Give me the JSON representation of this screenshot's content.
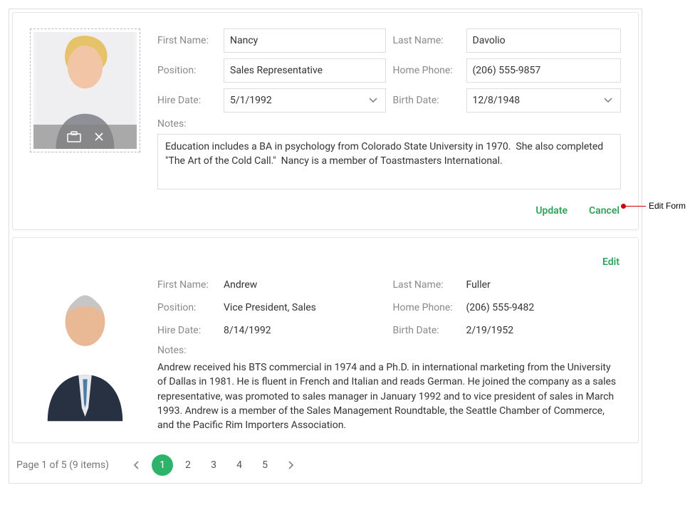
{
  "edit_card": {
    "labels": {
      "first_name": "First Name:",
      "last_name": "Last Name:",
      "position": "Position:",
      "home_phone": "Home Phone:",
      "hire_date": "Hire Date:",
      "birth_date": "Birth Date:",
      "notes": "Notes:"
    },
    "values": {
      "first_name": "Nancy",
      "last_name": "Davolio",
      "position": "Sales Representative",
      "home_phone": "(206) 555-9857",
      "hire_date": "5/1/1992",
      "birth_date": "12/8/1948",
      "notes": "Education includes a BA in psychology from Colorado State University in 1970.  She also completed \"The Art of the Cold Call.\"  Nancy is a member of Toastmasters International."
    },
    "buttons": {
      "update": "Update",
      "cancel": "Cancel"
    }
  },
  "read_card": {
    "edit_label": "Edit",
    "labels": {
      "first_name": "First Name:",
      "last_name": "Last Name:",
      "position": "Position:",
      "home_phone": "Home Phone:",
      "hire_date": "Hire Date:",
      "birth_date": "Birth Date:",
      "notes": "Notes:"
    },
    "values": {
      "first_name": "Andrew",
      "last_name": "Fuller",
      "position": "Vice President, Sales",
      "home_phone": "(206) 555-9482",
      "hire_date": "8/14/1992",
      "birth_date": "2/19/1952",
      "notes": "Andrew received his BTS commercial in 1974 and a Ph.D. in international marketing from the University of Dallas in 1981. He is fluent in French and Italian and reads German. He joined the company as a sales representative, was promoted to sales manager in January 1992 and to vice president of sales in March 1993. Andrew is a member of the Sales Management Roundtable, the Seattle Chamber of Commerce, and the Pacific Rim Importers Association."
    }
  },
  "pager": {
    "info": "Page 1 of 5 (9 items)",
    "pages": [
      "1",
      "2",
      "3",
      "4",
      "5"
    ],
    "active_index": 0
  },
  "callout": "Edit Form",
  "colors": {
    "accent": "#2eb36a",
    "accent_text": "#2fa35c",
    "border": "#ddd",
    "muted": "#8a8a8a"
  }
}
